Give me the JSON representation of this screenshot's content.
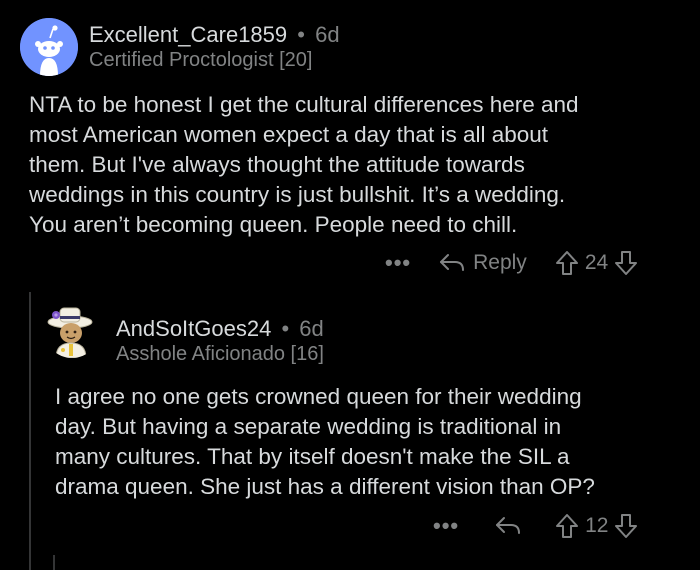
{
  "comments": [
    {
      "username": "Excellent_Care1859",
      "age": "6d",
      "flair": "Certified Proctologist [20]",
      "body_lines": [
        "NTA to be honest I get the cultural differences here and",
        "most American women expect a day that is all about",
        "them. But I've always thought the attitude towards",
        "weddings in this country is just bullshit. It’s a wedding.",
        "You aren’t becoming queen. People need to chill."
      ],
      "more_label": "•••",
      "reply_label": "Reply",
      "score": "24"
    },
    {
      "username": "AndSoItGoes24",
      "age": "6d",
      "flair": "Asshole Aficionado [16]",
      "body_lines": [
        "I agree no one gets crowned queen for their wedding",
        "day. But having a separate wedding is traditional in",
        "many cultures. That by itself doesn't make the SIL a",
        "drama queen. She just has a different vision than OP?"
      ],
      "more_label": "•••",
      "score": "12"
    }
  ],
  "separator": "•",
  "icons": {
    "avatar1": "snoo-avatar-icon",
    "avatar2": "custom-avatar-icon",
    "reply": "reply-arrow-icon",
    "upvote": "upvote-arrow-icon",
    "downvote": "downvote-arrow-icon"
  },
  "colors": {
    "background": "#000000",
    "text": "#d7dadc",
    "meta": "#818384",
    "avatar_bg": "#7193ff"
  }
}
